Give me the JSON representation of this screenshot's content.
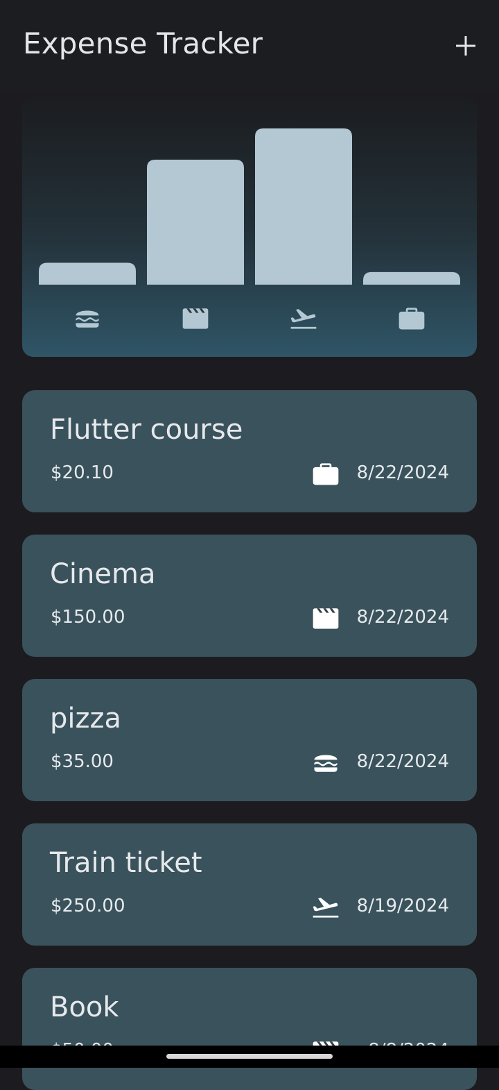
{
  "app_bar": {
    "title": "Expense Tracker",
    "add_icon": "plus-icon"
  },
  "chart_data": {
    "type": "bar",
    "categories": [
      "food",
      "leisure",
      "travel",
      "work"
    ],
    "category_icons": [
      "burger-icon",
      "clapperboard-icon",
      "flight-takeoff-icon",
      "briefcase-icon"
    ],
    "values": [
      35.0,
      200.0,
      250.0,
      20.1
    ],
    "ylim": [
      0,
      250
    ],
    "title": "",
    "xlabel": "",
    "ylabel": "",
    "bar_color": "#b4c8d4"
  },
  "expenses": [
    {
      "title": "Flutter course",
      "amount": "$20.10",
      "icon": "briefcase-icon",
      "date": "8/22/2024"
    },
    {
      "title": "Cinema",
      "amount": "$150.00",
      "icon": "clapperboard-icon",
      "date": "8/22/2024"
    },
    {
      "title": "pizza",
      "amount": "$35.00",
      "icon": "burger-icon",
      "date": "8/22/2024"
    },
    {
      "title": "Train ticket",
      "amount": "$250.00",
      "icon": "flight-takeoff-icon",
      "date": "8/19/2024"
    },
    {
      "title": "Book",
      "amount": "$50.00",
      "icon": "clapperboard-icon",
      "date": "8/8/2024"
    }
  ],
  "colors": {
    "background": "#1c1c20",
    "card": "#3a525c",
    "bar": "#b4c8d4",
    "text": "#e6e9ec"
  }
}
